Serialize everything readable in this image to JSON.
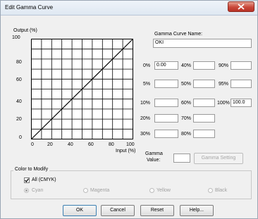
{
  "window": {
    "title": "Edit Gamma Curve"
  },
  "graph": {
    "y_label": "Output (%)",
    "x_label": "Input (%)",
    "y_ticks": [
      "100",
      "80",
      "60",
      "40",
      "20",
      "0"
    ],
    "x_ticks": [
      "0",
      "20",
      "40",
      "60",
      "80",
      "100"
    ]
  },
  "curve_name": {
    "label": "Gamma Curve Name:",
    "value": "OKI"
  },
  "points": [
    {
      "label": "0%",
      "value": "0.00"
    },
    {
      "label": "5%",
      "value": ""
    },
    {
      "label": "10%",
      "value": ""
    },
    {
      "label": "20%",
      "value": ""
    },
    {
      "label": "30%",
      "value": ""
    },
    {
      "label": "40%",
      "value": ""
    },
    {
      "label": "50%",
      "value": ""
    },
    {
      "label": "60%",
      "value": ""
    },
    {
      "label": "70%",
      "value": ""
    },
    {
      "label": "80%",
      "value": ""
    },
    {
      "label": "90%",
      "value": ""
    },
    {
      "label": "95%",
      "value": ""
    },
    {
      "label": "100%",
      "value": "100.0"
    }
  ],
  "gamma": {
    "label_line1": "Gamma",
    "label_line2": "Value:",
    "value": "",
    "button": "Gamma Setting"
  },
  "color_group": {
    "title": "Color to Modify",
    "all_label": "All (CMYK)",
    "all_checked": true,
    "options": [
      "Cyan",
      "Magenta",
      "Yellow",
      "Black"
    ],
    "selected": "Cyan"
  },
  "buttons": {
    "ok": "OK",
    "cancel": "Cancel",
    "reset": "Reset",
    "help": "Help..."
  }
}
